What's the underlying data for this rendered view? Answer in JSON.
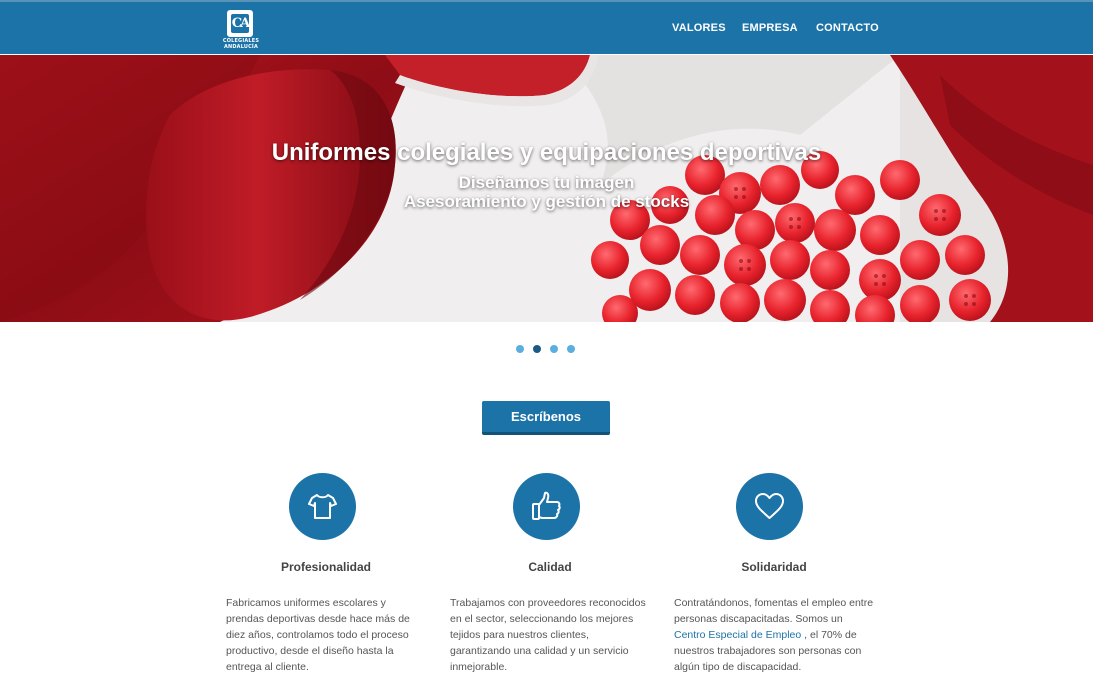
{
  "header": {
    "logo_monogram": "CA",
    "logo_line1": "COLEGIALES",
    "logo_line2": "ANDALUCÍA",
    "nav": [
      {
        "label": "VALORES"
      },
      {
        "label": "EMPRESA"
      },
      {
        "label": "CONTACTO"
      }
    ]
  },
  "hero": {
    "title": "Uniformes colegiales y equipaciones deportivas",
    "subtitle_line1": "Diseñamos tu imagen",
    "subtitle_line2": "Asesoramiento y gestión de stocks"
  },
  "carousel": {
    "slide_count": 4,
    "active_index": 1
  },
  "cta": {
    "label": "Escríbenos"
  },
  "features": [
    {
      "icon": "tshirt-icon",
      "title": "Profesionalidad",
      "text": "Fabricamos uniformes escolares y prendas deportivas desde hace más de diez años, controlamos todo el proceso productivo, desde el diseño hasta la entrega al cliente."
    },
    {
      "icon": "thumbs-up-icon",
      "title": "Calidad",
      "text": "Trabajamos con proveedores reconocidos en el sector, seleccionando los mejores tejidos para nuestros clientes, garantizando una calidad y un servicio inmejorable."
    },
    {
      "icon": "heart-icon",
      "title": "Solidaridad",
      "text_before": "Contratándonos, fomentas el empleo entre personas discapacitadas. Somos un ",
      "link": "Centro Especial de Empleo",
      "text_after": " , el 70% de nuestros trabajadores son personas con algún tipo de discapacidad."
    }
  ],
  "colors": {
    "brand": "#1c73a8",
    "dot": "#5aaee0",
    "dot_active": "#1c5a86"
  }
}
